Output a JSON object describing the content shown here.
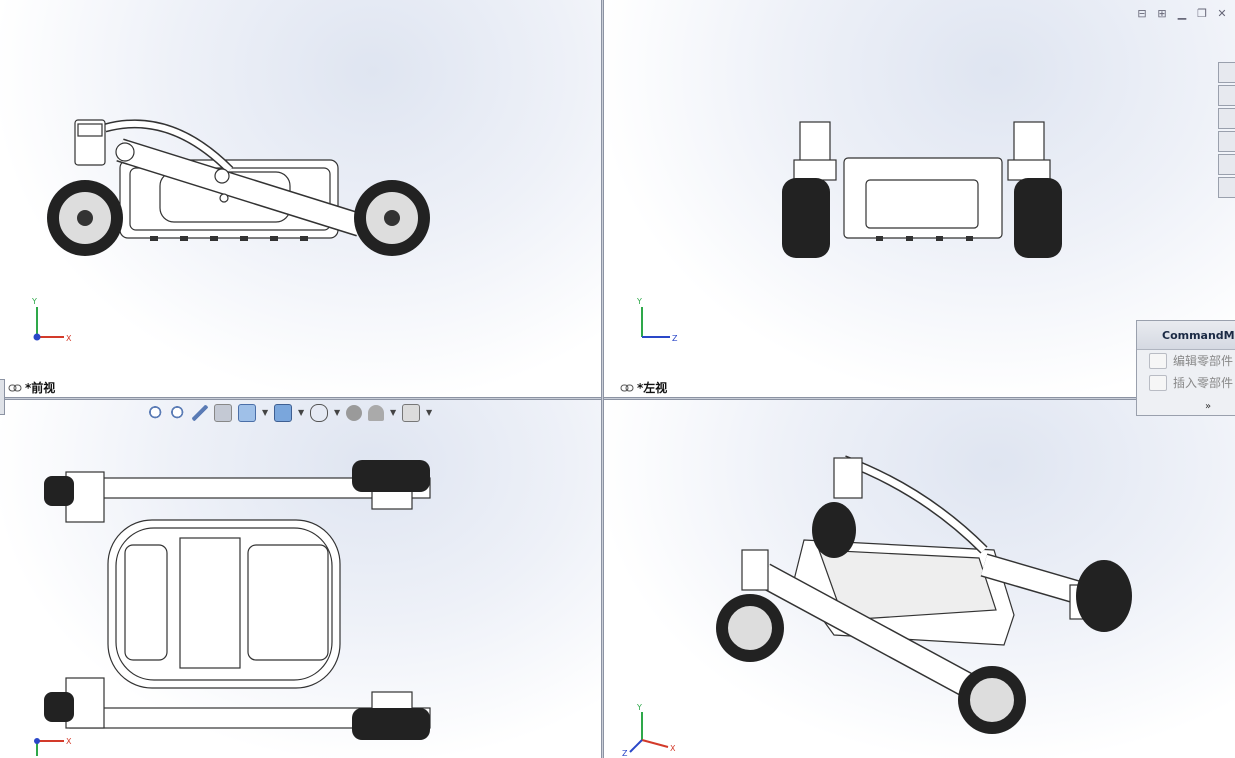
{
  "viewports": {
    "front": {
      "label": "*前视",
      "triad": {
        "up": "Y",
        "right": "X"
      }
    },
    "left": {
      "label": "*左视",
      "triad": {
        "up": "Y",
        "right": "Z"
      }
    },
    "top": {
      "label": "",
      "triad": {
        "up": "",
        "right": "X"
      }
    },
    "iso": {
      "label": "",
      "triad": {
        "up": "Y",
        "right": "X",
        "depth": "Z"
      }
    }
  },
  "command_manager": {
    "title": "CommandMan",
    "items": [
      "编辑零部件",
      "插入零部件"
    ],
    "more": "»"
  },
  "heads_up_toolbar": [
    "zoom-to-fit-icon",
    "zoom-to-area-icon",
    "previous-view-icon",
    "section-view-icon",
    "view-orientation-icon",
    "display-style-icon",
    "hide-show-icon",
    "edit-appearance-icon",
    "apply-scene-icon",
    "view-settings-icon"
  ],
  "window_controls": [
    "tile-horizontal-icon",
    "tile-vertical-icon",
    "minimize-icon",
    "restore-icon",
    "close-icon"
  ],
  "colors": {
    "axis_x": "#d33a2a",
    "axis_y": "#2ea84a",
    "axis_z": "#2a47c8",
    "divider": "#c9ced8"
  }
}
